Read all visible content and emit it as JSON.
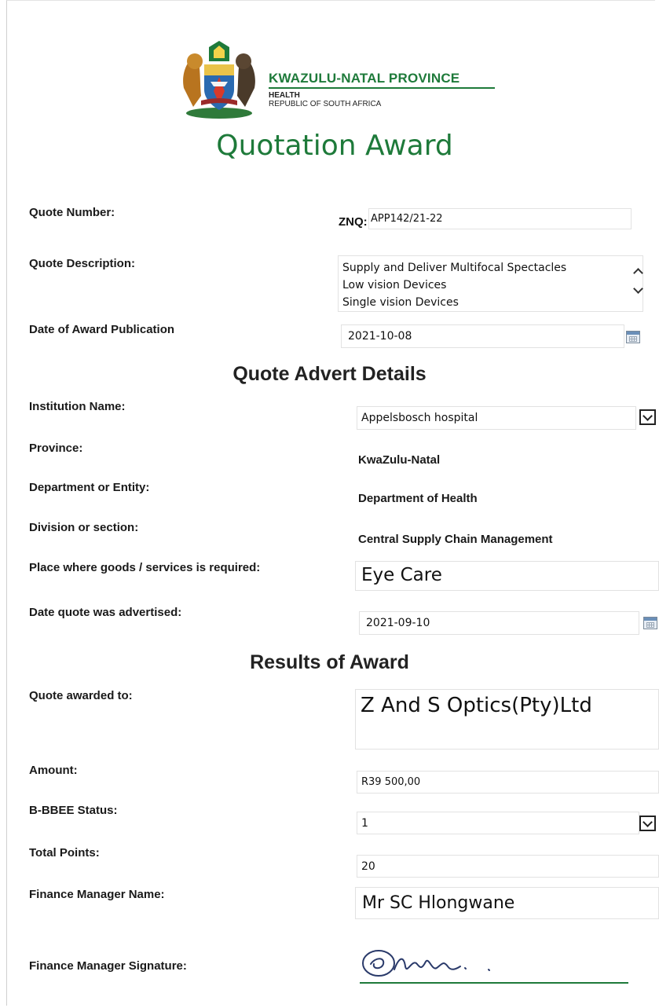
{
  "header": {
    "org_title": "KWAZULU-NATAL PROVINCE",
    "org_sub1": "HEALTH",
    "org_sub2": "REPUBLIC OF SOUTH AFRICA",
    "doc_title": "Quotation Award",
    "brand_green": "#1e7a3a"
  },
  "quote": {
    "number_label": "Quote Number:",
    "number_prefix": "ZNQ:",
    "number_value": "APP142/21-22",
    "description_label": "Quote Description:",
    "description_lines": [
      "Supply and Deliver Multifocal Spectacles",
      "Low vision Devices",
      "Single vision Devices"
    ],
    "award_date_label": "Date of Award Publication",
    "award_date_value": "2021-10-08"
  },
  "advert": {
    "heading": "Quote Advert Details",
    "institution_label": "Institution Name:",
    "institution_value": "Appelsbosch hospital",
    "province_label": "Province:",
    "province_value": "KwaZulu-Natal",
    "department_label": "Department or Entity:",
    "department_value": "Department of Health",
    "division_label": "Division or section:",
    "division_value": "Central Supply Chain Management",
    "place_label": "Place where goods /  services is required:",
    "place_value": "Eye Care",
    "advertised_label": "Date quote was advertised:",
    "advertised_value": "2021-09-10"
  },
  "results": {
    "heading": "Results of Award",
    "awarded_to_label": "Quote awarded to:",
    "awarded_to_value": "Z And S Optics(Pty)Ltd",
    "amount_label": "Amount:",
    "amount_value": "R39 500,00",
    "bbbee_label": "B-BBEE Status:",
    "bbbee_value": "1",
    "points_label": "Total Points:",
    "points_value": "20",
    "finance_name_label": "Finance Manager Name:",
    "finance_name_value": "Mr SC Hlongwane",
    "finance_sig_label": "Finance Manager Signature:"
  },
  "icons": {
    "coat_of_arms": "coat-of-arms-logo",
    "calendar": "calendar-icon",
    "dropdown": "chevron-down-icon",
    "scroll_up": "chevron-up-icon",
    "scroll_down": "chevron-down-icon"
  }
}
